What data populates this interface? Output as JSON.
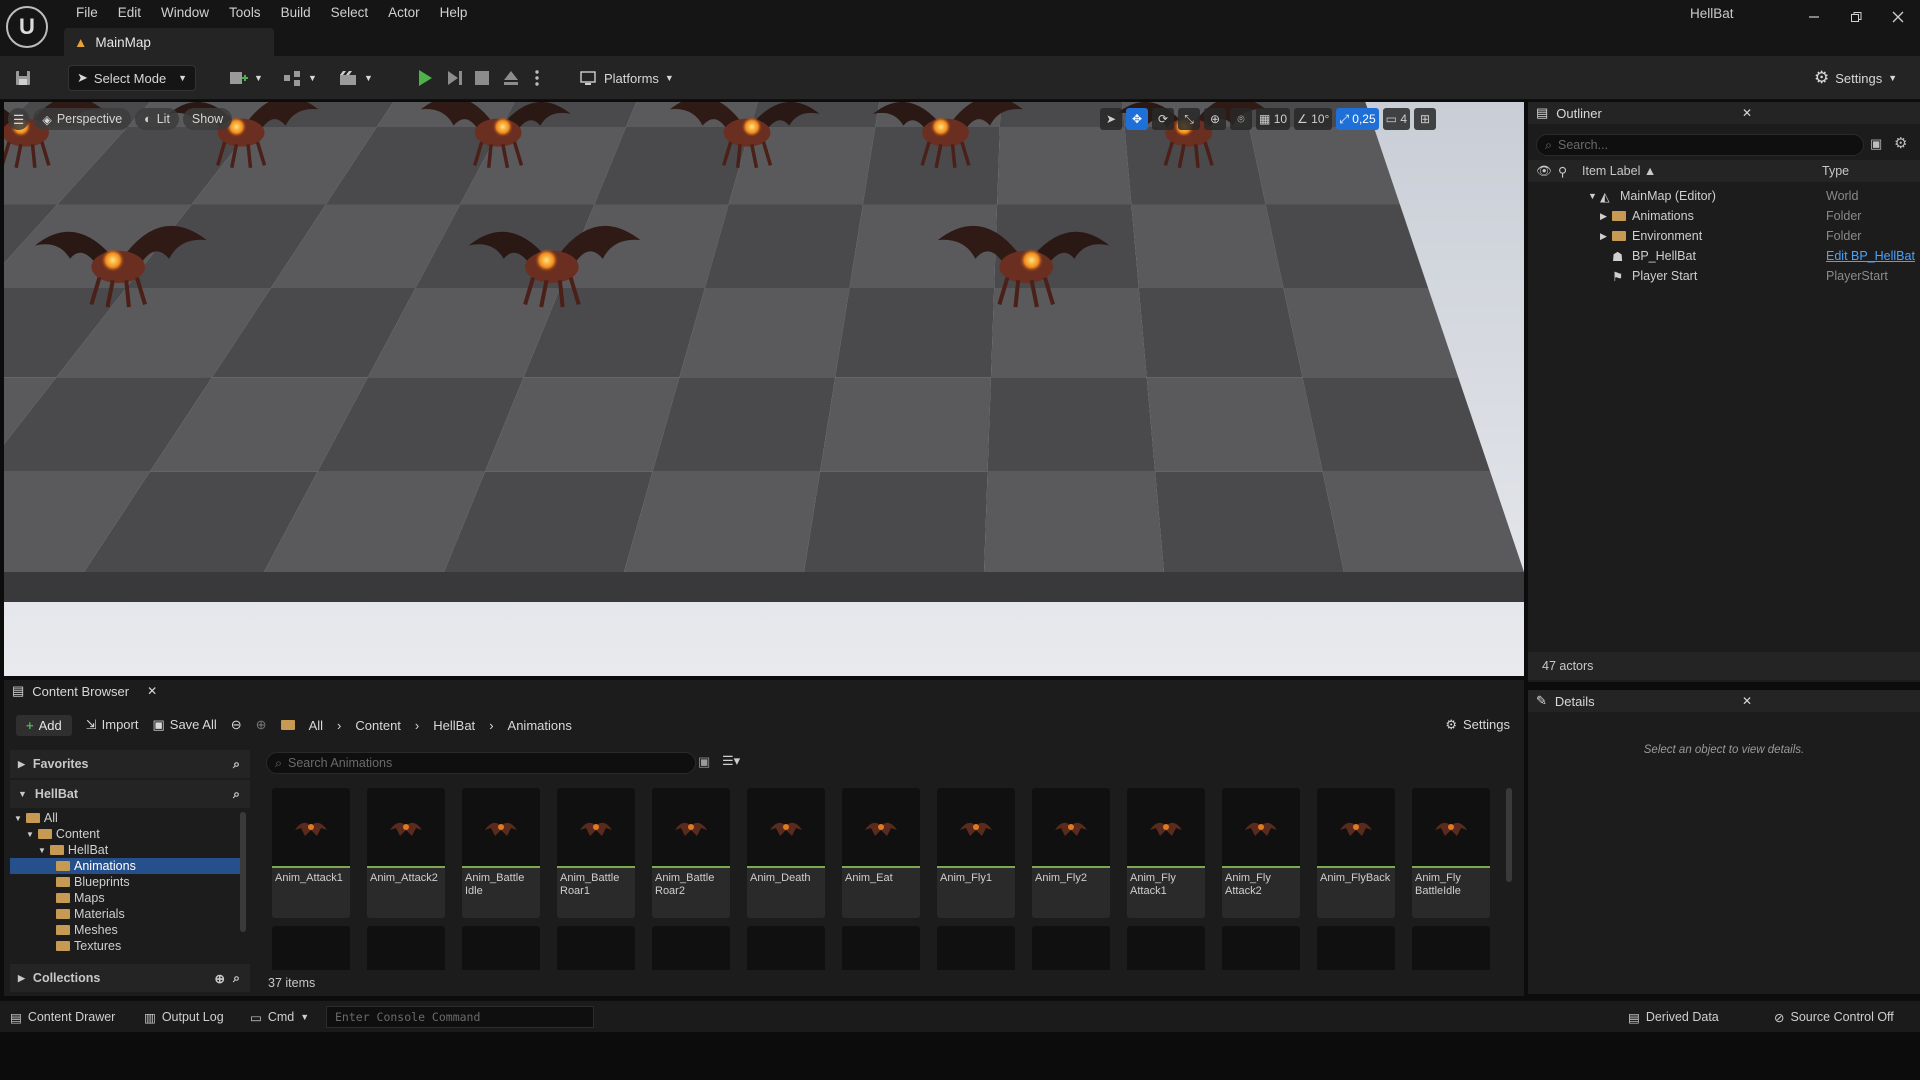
{
  "app": {
    "window_title": "HellBat",
    "map_tab": "MainMap",
    "logo": "U"
  },
  "menu": [
    "File",
    "Edit",
    "Window",
    "Tools",
    "Build",
    "Select",
    "Actor",
    "Help"
  ],
  "toolbar": {
    "select_mode": "Select Mode",
    "platforms": "Platforms",
    "settings": "Settings"
  },
  "viewport": {
    "perspective": "Perspective",
    "lit": "Lit",
    "show": "Show",
    "grid_snap": "10",
    "rotation_snap": "10°",
    "scale_snap": "0,25",
    "camera_speed": "4",
    "colors": {
      "floor_light": "#5a5a5d",
      "floor_dark": "#4a4a4d",
      "sky": "#d8dde5",
      "accent": "#1e6fd8"
    }
  },
  "outliner": {
    "title": "Outliner",
    "search_placeholder": "Search...",
    "col_label": "Item Label",
    "col_type": "Type",
    "items": [
      {
        "label": "MainMap (Editor)",
        "type": "World"
      },
      {
        "label": "Animations",
        "type": "Folder"
      },
      {
        "label": "Environment",
        "type": "Folder"
      },
      {
        "label": "BP_HellBat",
        "type": "Edit BP_HellBat"
      },
      {
        "label": "Player Start",
        "type": "PlayerStart"
      }
    ],
    "actor_count": "47 actors"
  },
  "details": {
    "title": "Details",
    "empty": "Select an object to view details."
  },
  "content_browser": {
    "title": "Content Browser",
    "add": "Add",
    "import": "Import",
    "save_all": "Save All",
    "settings": "Settings",
    "breadcrumb": [
      "All",
      "Content",
      "HellBat",
      "Animations"
    ],
    "favorites": "Favorites",
    "project": "HellBat",
    "collections": "Collections",
    "tree": [
      "All",
      "Content",
      "HellBat",
      "Animations",
      "Blueprints",
      "Maps",
      "Materials",
      "Meshes",
      "Textures"
    ],
    "search_placeholder": "Search Animations",
    "item_count": "37 items",
    "assets": [
      "Anim_Attack1",
      "Anim_Attack2",
      "Anim_Battle Idle",
      "Anim_Battle Roar1",
      "Anim_Battle Roar2",
      "Anim_Death",
      "Anim_Eat",
      "Anim_Fly1",
      "Anim_Fly2",
      "Anim_Fly Attack1",
      "Anim_Fly Attack2",
      "Anim_FlyBack",
      "Anim_Fly BattleIdle"
    ]
  },
  "statusbar": {
    "content_drawer": "Content Drawer",
    "output_log": "Output Log",
    "cmd": "Cmd",
    "console_placeholder": "Enter Console Command",
    "derived_data": "Derived Data",
    "source_control": "Source Control Off"
  }
}
